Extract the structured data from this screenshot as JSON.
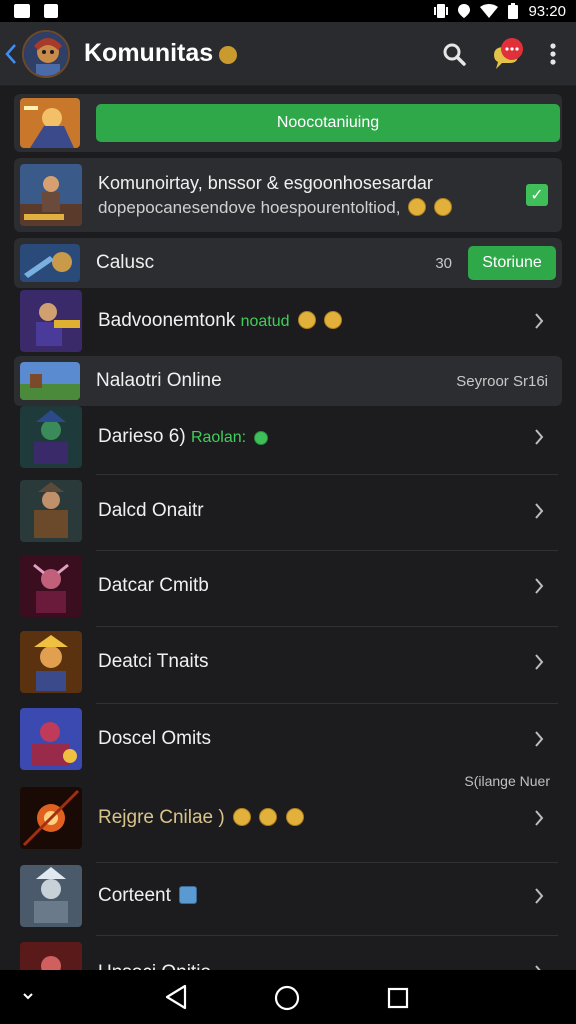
{
  "status_bar": {
    "time": "93:20"
  },
  "app_bar": {
    "title": "Komunitas"
  },
  "rows": {
    "banner": {
      "button_label": "Noocotaniuing"
    },
    "row1": {
      "title": "Komunoirtay, bnssor & esgoonhosesardar",
      "subtitle": "dopepocanesendove hoespourentoltiod,"
    },
    "row2": {
      "title": "Calusc",
      "count": "30",
      "button_label": "Storiune"
    },
    "row3": {
      "title": "Badvoonemtonk",
      "status": "noatud"
    },
    "row4": {
      "title": "Nalaotri Online",
      "meta": "Seyroor Sr16i"
    },
    "row5": {
      "title": "Darieso 6)",
      "status": "Raolan:"
    },
    "row6": {
      "title": "Dalcd Onaitr"
    },
    "row7": {
      "title": "Datcar Cmitb"
    },
    "row8": {
      "title": "Deatci Tnaits"
    },
    "row9": {
      "title": "Doscel Omits",
      "note": "S(ilange Nuer"
    },
    "row10": {
      "title": "Rejgre Cnilae )"
    },
    "row11": {
      "title": "Corteent"
    },
    "row12": {
      "title": "Unsoci Onitio"
    }
  },
  "icons": {
    "back": "back-chevron-icon",
    "search": "search-icon",
    "chat": "chat-bubble-icon",
    "more": "more-vert-icon",
    "row_arrow": "chevron-right-icon",
    "check": "check-icon"
  },
  "colors": {
    "background": "#1c1c1e",
    "app_bar": "#2a2b2e",
    "accent_green": "#2fa84a",
    "back_blue": "#3e8ef7",
    "chat_red": "#e0303a"
  }
}
